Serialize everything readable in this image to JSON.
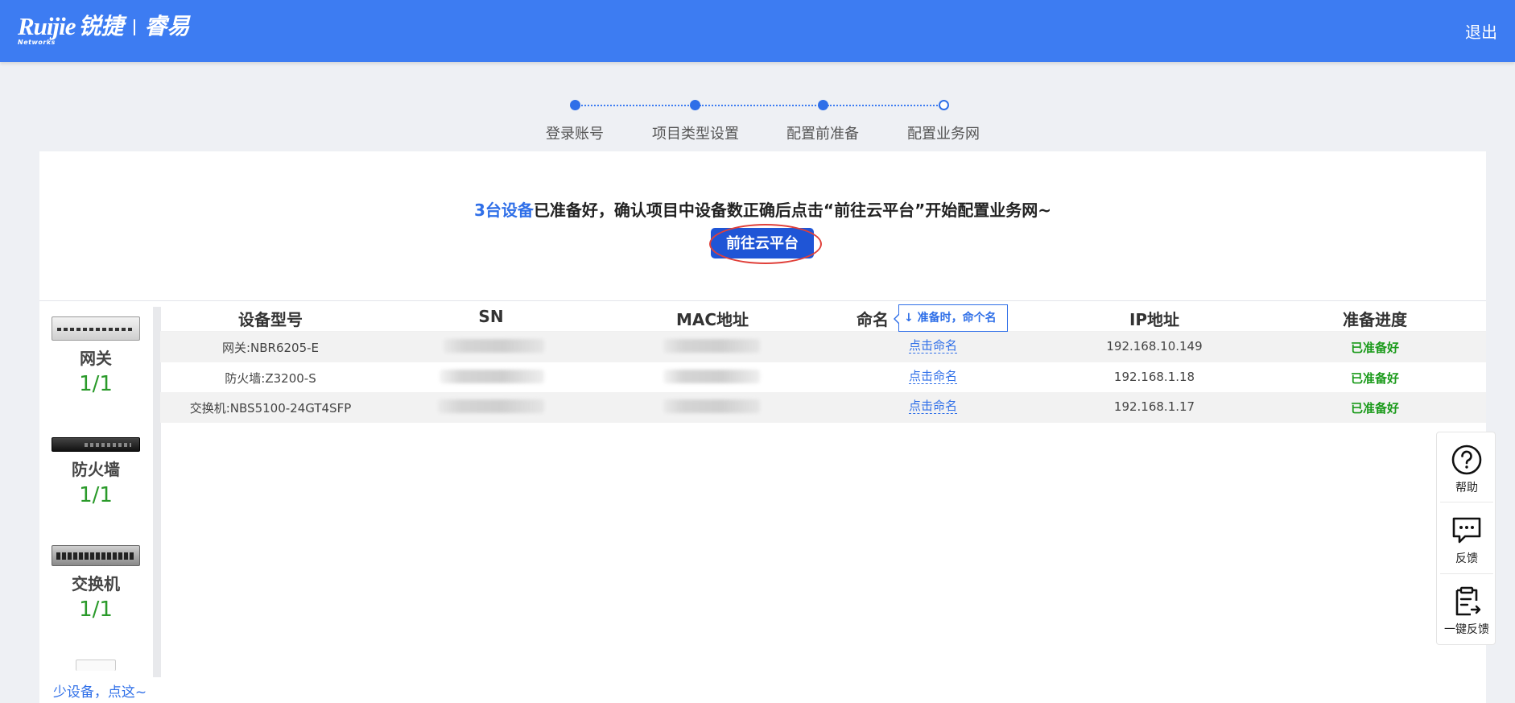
{
  "header": {
    "logo_brand": "Ruijie",
    "logo_networks": "Networks",
    "logo_cn_brand": "锐捷",
    "logo_product": "睿易",
    "logout_label": "退出"
  },
  "stepper": {
    "steps": [
      {
        "label": "登录账号",
        "state": "done"
      },
      {
        "label": "项目类型设置",
        "state": "done"
      },
      {
        "label": "配置前准备",
        "state": "done"
      },
      {
        "label": "配置业务网",
        "state": "pending"
      }
    ]
  },
  "banner": {
    "count_text": "3台设备",
    "message_text": "已准备好，确认项目中设备数正确后点击“前往云平台”开始配置业务网~",
    "cloud_button_label": "前往云平台"
  },
  "devices": {
    "items": [
      {
        "name": "网关",
        "count": "1/1",
        "icon": "gateway-device-image"
      },
      {
        "name": "防火墙",
        "count": "1/1",
        "icon": "firewall-device-image"
      },
      {
        "name": "交换机",
        "count": "1/1",
        "icon": "switch-device-image"
      }
    ],
    "few_devices_link": "少设备，点这~"
  },
  "table": {
    "columns": [
      "设备型号",
      "SN",
      "MAC地址",
      "命名",
      "IP地址",
      "准备进度"
    ],
    "name_tip": "准备时，命个名",
    "rows": [
      {
        "model": "网关:NBR6205-E",
        "name_action": "点击命名",
        "ip": "192.168.10.149",
        "status": "已准备好"
      },
      {
        "model": "防火墙:Z3200-S",
        "name_action": "点击命名",
        "ip": "192.168.1.18",
        "status": "已准备好"
      },
      {
        "model": "交换机:NBS5100-24GT4SFP",
        "name_action": "点击命名",
        "ip": "192.168.1.17",
        "status": "已准备好"
      }
    ]
  },
  "float_panel": {
    "help_label": "帮助",
    "feedback_label": "反馈",
    "quick_feedback_label": "一键反馈"
  },
  "colors": {
    "brand_blue": "#3d7cf2",
    "button_blue": "#1f55d6",
    "ready_green": "#1a9a1a",
    "highlight_red": "#e0403a"
  }
}
